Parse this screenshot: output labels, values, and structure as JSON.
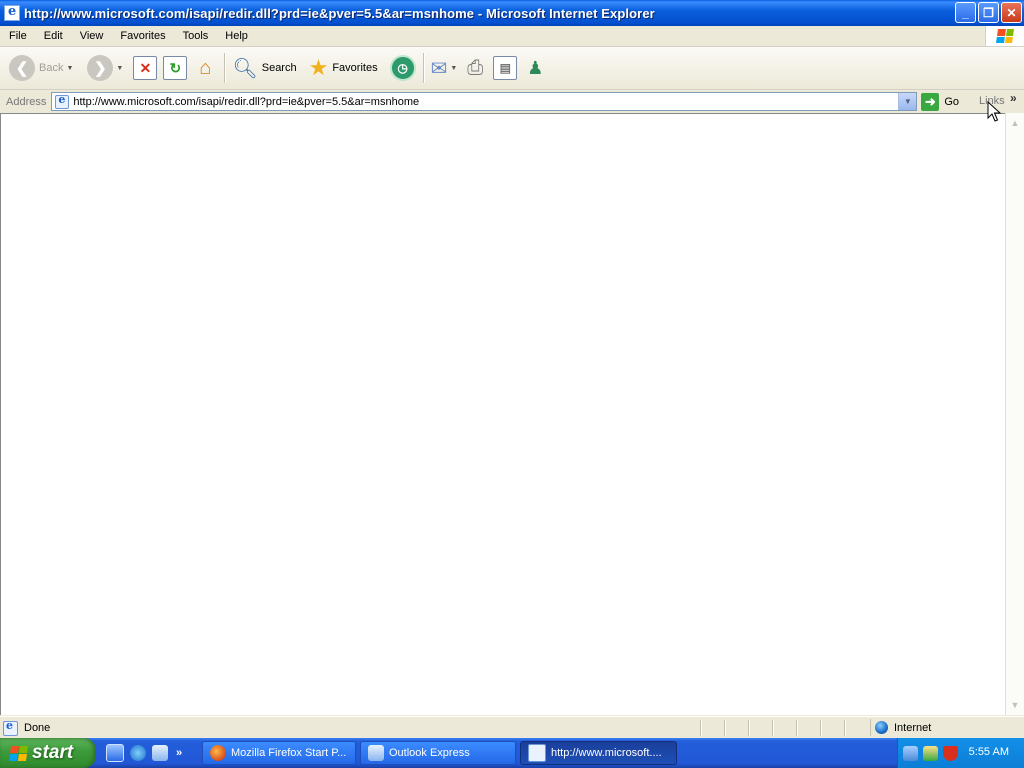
{
  "window": {
    "title": "http://www.microsoft.com/isapi/redir.dll?prd=ie&pver=5.5&ar=msnhome - Microsoft Internet Explorer",
    "controls": [
      "minimize-icon",
      "restore-icon",
      "close-icon"
    ]
  },
  "menubar": {
    "items": [
      "File",
      "Edit",
      "View",
      "Favorites",
      "Tools",
      "Help"
    ]
  },
  "toolbar": {
    "back_label": "Back",
    "search_label": "Search",
    "favorites_label": "Favorites",
    "icons": [
      "back-icon",
      "forward-icon",
      "stop-icon",
      "refresh-icon",
      "home-icon",
      "search-icon",
      "favorites-star-icon",
      "history-icon",
      "mail-icon",
      "print-icon",
      "edit-icon",
      "messenger-icon"
    ]
  },
  "addressbar": {
    "label": "Address",
    "url": "http://www.microsoft.com/isapi/redir.dll?prd=ie&pver=5.5&ar=msnhome",
    "go_label": "Go",
    "links_label": "Links",
    "more_label": "»"
  },
  "statusbar": {
    "status": "Done",
    "zone": "Internet"
  },
  "taskbar": {
    "start_label": "start",
    "quicklaunch_more": "»",
    "tasks": [
      {
        "label": "Mozilla Firefox Start P...",
        "active": false
      },
      {
        "label": "Outlook Express",
        "active": false
      },
      {
        "label": "http://www.microsoft....",
        "active": true
      }
    ],
    "clock": "5:55 AM"
  },
  "colors": {
    "titlebar": "#0a5fdc",
    "taskbar": "#245edb",
    "start_button": "#3c9a3a",
    "chrome_bg": "#ece9d8",
    "tray": "#0c7ed6"
  }
}
